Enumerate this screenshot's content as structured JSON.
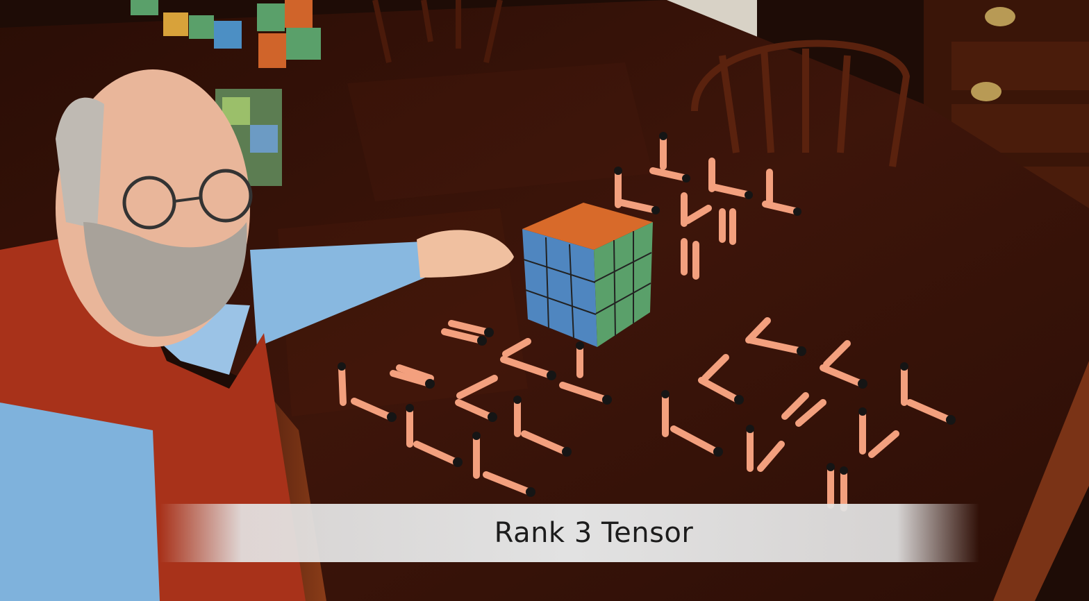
{
  "caption": {
    "text": "Rank 3 Tensor"
  },
  "colors": {
    "table": "#3a1409",
    "table_edge": "#7a3316",
    "vest": "#a8321a",
    "shirt": "#7fb2dc",
    "dart": "#f3a07e",
    "dart_tip": "#151515",
    "caption_bar": "#e2e2e2"
  }
}
